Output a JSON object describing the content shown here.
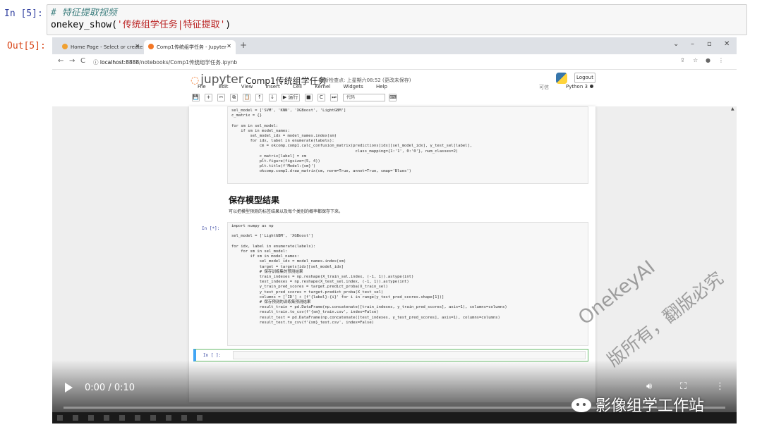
{
  "notebook": {
    "in_prompt": "In  [5]:",
    "input_comment": "# 特征提取视频",
    "input_func": "onekey_show(",
    "input_string": "'传统组学任务|特征提取'",
    "input_close": ")",
    "out_prompt": "Out[5]:"
  },
  "browser": {
    "tabs": [
      {
        "label": "Home Page - Select or create",
        "color": "#f0a030"
      },
      {
        "label": "Comp1传统组学任务 - Jupyter",
        "color": "#f37726"
      }
    ],
    "new_tab": "+",
    "url_host": "localhost:8888",
    "url_path": "/notebooks/Comp1传统组学任务.ipynb",
    "window_controls": [
      "⌄",
      "–",
      "▫",
      "✕"
    ]
  },
  "jupyter": {
    "logo": "jupyter",
    "title": "Comp1传统组学任务",
    "saved_status": "最新检查点: 上星期六08:52  (更改未保存)",
    "logout": "Logout",
    "menu": [
      "File",
      "Edit",
      "View",
      "Insert",
      "Cell",
      "Kernel",
      "Widgets",
      "Help"
    ],
    "trusted": "可信",
    "kernel": "Python 3",
    "cell_type": "代码",
    "toolbar_buttons": [
      "💾",
      "+",
      "✂",
      "⧉",
      "📋",
      "↑",
      "↓",
      "▶ 运行",
      "■",
      "C",
      "⏭"
    ]
  },
  "cells": {
    "cell1_code": "sel_model = ['SVM', 'KNN', 'XGBoost', 'LightGBM']\nc_matrix = {}\n\nfor sm in sel_model:\n    if sm in model_names:\n        sel_model_idx = model_names.index(sm)\n        for idx, label in enumerate(labels):\n            cm = okcomp.comp1.calc_confusion_matrix(predictions[idx][sel_model_idx], y_test_sel[label],\n                                                     class_mapping={1:'1', 0:'0'}, num_classes=2)\n            c_matrix[label] = cm\n            plt.figure(figsize=(5, 4))\n            plt.title(f'Model:{sm}')\n            okcomp.comp1.draw_matrix(cm, norm=True, annot=True, cmap='Blues')",
    "heading": "保存模型结果",
    "heading_text": "可以把模型预测的标签结果以及每个类别的概率都保存下来。",
    "cell2_prompt": "In  [*]:",
    "cell2_code": "import numpy as np\n\nsel_model = ['LightGBM', 'XGBoost']\n\nfor idx, label in enumerate(labels):\n    for sm in sel_model:\n        if sm in model_names:\n            sel_model_idx = model_names.index(sm)\n            target = targets[idx][sel_model_idx]\n            # 保存训练集的预测结果\n            train_indexes = np.reshape(X_train_sel.index, (-1, 1)).astype(int)\n            test_indexes = np.reshape(X_test_sel.index, (-1, 1)).astype(int)\n            y_train_pred_scores = target.predict_proba(X_train_sel)\n            y_test_pred_scores = target.predict_proba(X_test_sel)\n            columns = ['ID'] + [f'{label}-{i}' for i in range(y_test_pred_scores.shape[1])]\n            # 保存预测的训练集预测结果\n            result_train = pd.DataFrame(np.concatenate([train_indexes, y_train_pred_scores], axis=1), columns=columns)\n            result_train.to_csv(f'{sm}_train.csv', index=False)\n            result_test = pd.DataFrame(np.concatenate([test_indexes, y_test_pred_scores], axis=1), columns=columns)\n            result_test.to_csv(f'{sm}_test.csv', index=False)",
    "empty_prompt": "In  [ ]:"
  },
  "watermark": {
    "line1": "OnekeyAI",
    "line2": "版所有，翻版必究"
  },
  "video": {
    "time": "0:00 / 0:10",
    "progress_fraction": 0.0,
    "play_icon": "play-icon",
    "volume_icon": "volume-icon",
    "fullscreen_icon": "fullscreen-icon",
    "more_icon": "more-options-icon"
  },
  "brand": {
    "text": "影像组学工作站"
  }
}
